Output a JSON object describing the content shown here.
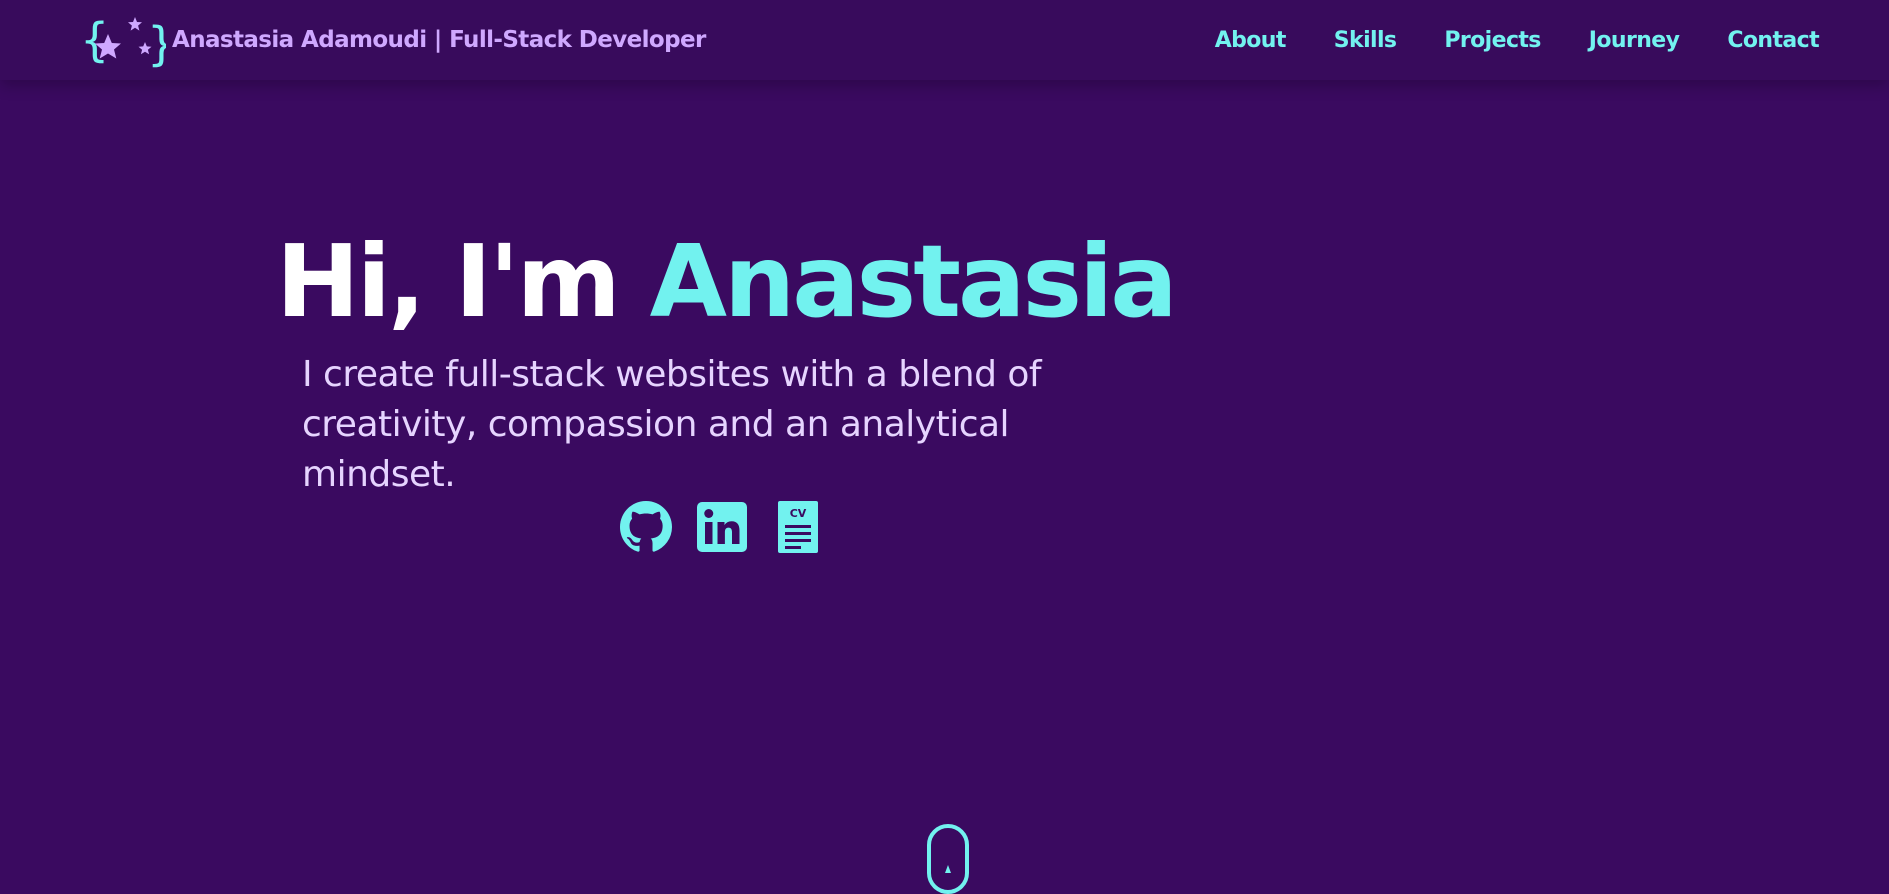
{
  "colors": {
    "background": "#3a0a60",
    "navbar": "#380b5c",
    "accent": "#72f2ef",
    "brand_text": "#cfa8ff",
    "heading_text": "#ffffff",
    "body_text": "#e6d4ff"
  },
  "header": {
    "logo_icon": "curly-braces-stars-icon",
    "brand_name": "Anastasia Adamoudi | Full-Stack Developer"
  },
  "nav": {
    "items": [
      {
        "label": "About"
      },
      {
        "label": "Skills"
      },
      {
        "label": "Projects"
      },
      {
        "label": "Journey"
      },
      {
        "label": "Contact"
      }
    ]
  },
  "hero": {
    "greeting": "Hi, I'm ",
    "name": "Anastasia",
    "tagline": "I create full-stack websites with a blend of creativity, compassion and an analytical mindset."
  },
  "socials": [
    {
      "icon": "github-icon"
    },
    {
      "icon": "linkedin-icon"
    },
    {
      "icon": "cv-document-icon",
      "label": "CV"
    }
  ],
  "scroll_indicator": {
    "icon": "mouse-scroll-icon"
  }
}
